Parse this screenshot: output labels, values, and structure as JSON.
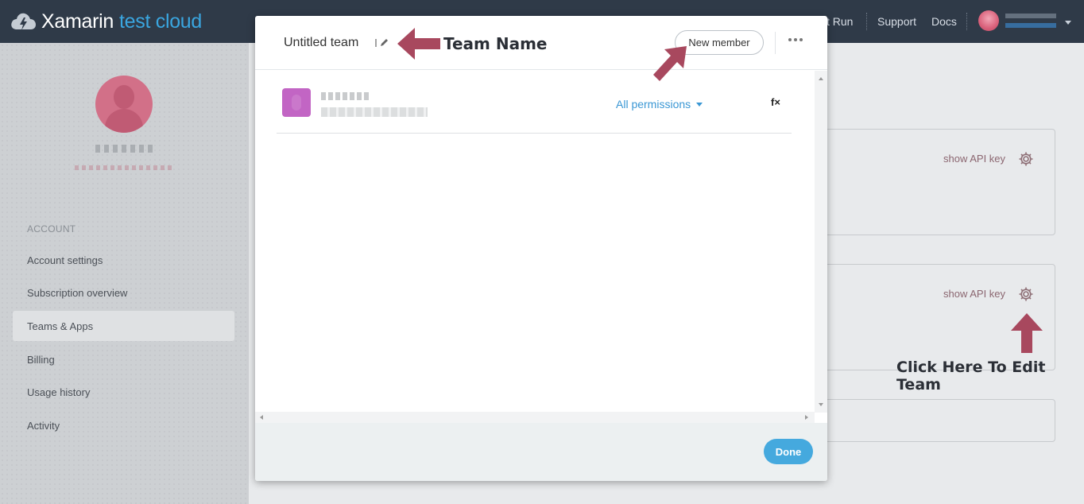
{
  "app": {
    "logo_main": "Xamarin",
    "logo_sub": "test cloud"
  },
  "topnav": {
    "run_label": "t Run",
    "support_label": "Support",
    "docs_label": "Docs"
  },
  "sidebar": {
    "heading": "ACCOUNT",
    "items": [
      {
        "label": "Account settings"
      },
      {
        "label": "Subscription overview"
      },
      {
        "label": "Teams & Apps"
      },
      {
        "label": "Billing"
      },
      {
        "label": "Usage history"
      },
      {
        "label": "Activity"
      }
    ],
    "active_item": "Teams & Apps"
  },
  "background": {
    "api_key_label_1": "show API key",
    "api_key_label_2": "show API key"
  },
  "modal": {
    "team_name": "Untitled team",
    "new_member_label": "New member",
    "member": {
      "permissions_label": "All permissions",
      "remove_label": "f×"
    },
    "done_label": "Done"
  },
  "annotations": {
    "team_name_note": "Team Name",
    "edit_team_note": "Click Here To Edit Team"
  },
  "colors": {
    "topbar": "#2f3a48",
    "accent_blue": "#3aa6e0",
    "done_button": "#45a9de",
    "annotation_arrow": "#a8485e",
    "member_avatar": "#c265c4"
  }
}
